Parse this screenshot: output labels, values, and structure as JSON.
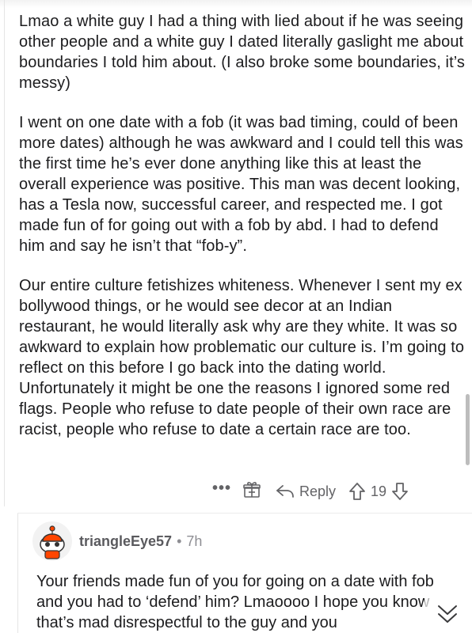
{
  "comment": {
    "paragraphs": [
      "Lmao a white guy I had a thing with lied about if he was seeing other people and a white guy I dated literally gaslight me about boundaries I told him about. (I also broke some boundaries, it’s messy)",
      "I went on one date with a fob (it was bad timing, could of been more dates) although he was awkward and I could tell this was the first time he’s ever done anything like this at least the overall experience was positive. This man was decent looking, has a Tesla now, successful career, and respected me. I got made fun of for going out with a fob by abd. I had to defend him and say he isn’t that “fob-y”.",
      "Our entire culture fetishizes whiteness. Whenever I sent my ex bollywood things, or he would see decor at an Indian restaurant, he would literally ask why are they white. It was so awkward to explain how problematic our culture is. I’m going to reflect on this before I go back into the dating world. Unfortunately it might be one the reasons I ignored some red flags. People who refuse to date people of their own race are racist, people who refuse to date a certain race are too."
    ],
    "actions": {
      "more_label": "•••",
      "reply_label": "Reply",
      "vote_count": "19"
    }
  },
  "reply": {
    "username": "triangleEye57",
    "separator": "•",
    "age": "7h",
    "text": "Your friends made fun of you for going on a date with fob and you had to ‘defend’ him? Lmaoooo I hope you know that’s mad disrespectful to the guy and you"
  },
  "icons": {
    "more": "ellipsis-icon",
    "award": "gift-icon",
    "reply": "reply-arrow-icon",
    "upvote": "upvote-arrow-icon",
    "downvote": "downvote-arrow-icon",
    "collapse": "chevron-down-double-icon"
  },
  "colors": {
    "text": "#1c1c1e",
    "meta": "#636366",
    "avatar_accent": "#ff4500"
  }
}
